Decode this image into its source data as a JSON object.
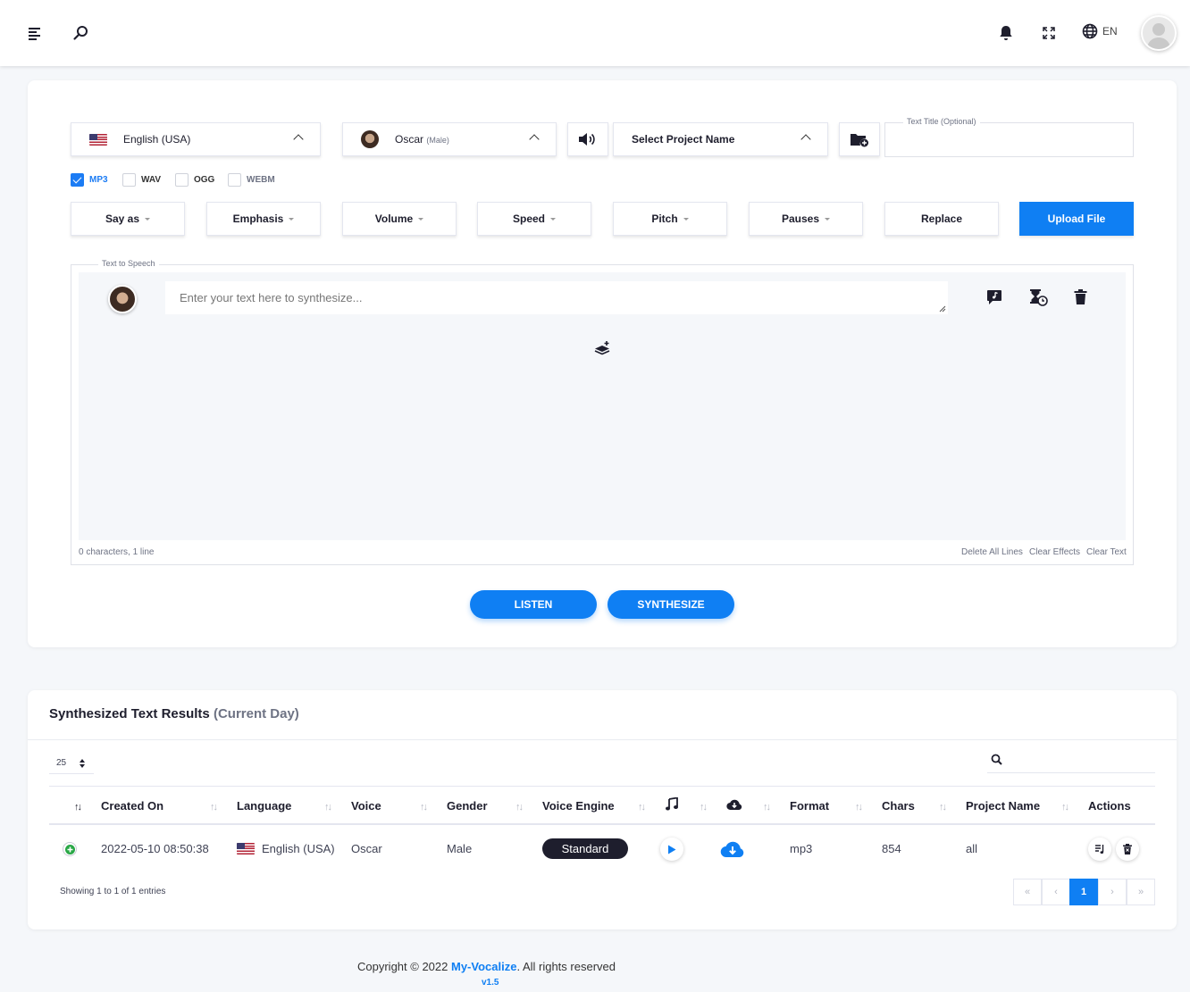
{
  "header": {
    "language_code": "EN"
  },
  "voice_panel": {
    "language": "English (USA)",
    "voice_name": "Oscar",
    "voice_gender_tag": "(Male)",
    "project_placeholder": "Select Project Name",
    "text_title_legend": "Text Title (Optional)"
  },
  "formats": [
    {
      "label": "MP3",
      "checked": true
    },
    {
      "label": "WAV",
      "checked": false
    },
    {
      "label": "OGG",
      "checked": false
    },
    {
      "label": "WEBM",
      "checked": false
    }
  ],
  "effects": [
    "Say as",
    "Emphasis",
    "Volume",
    "Speed",
    "Pitch",
    "Pauses",
    "Replace"
  ],
  "upload_label": "Upload File",
  "tts": {
    "legend": "Text to Speech",
    "placeholder": "Enter your text here to synthesize...",
    "counter": "0 characters, 1 line",
    "delete_all": "Delete All Lines",
    "clear_effects": "Clear Effects",
    "clear_text": "Clear Text"
  },
  "actions": {
    "listen": "LISTEN",
    "synthesize": "SYNTHESIZE"
  },
  "results": {
    "title": "Synthesized Text Results",
    "title_suffix": "(Current Day)",
    "page_size": "25",
    "columns": [
      "Created On",
      "Language",
      "Voice",
      "Gender",
      "Voice Engine",
      "Format",
      "Chars",
      "Project Name",
      "Actions"
    ],
    "rows": [
      {
        "created_on": "2022-05-10 08:50:38",
        "language": "English (USA)",
        "voice": "Oscar",
        "gender": "Male",
        "engine": "Standard",
        "format": "mp3",
        "chars": "854",
        "project": "all"
      }
    ],
    "info": "Showing 1 to 1 of 1 entries",
    "current_page": "1"
  },
  "footer": {
    "copyright_prefix": "Copyright © 2022 ",
    "brand": "My-Vocalize",
    "copyright_suffix": ". All rights reserved",
    "version": "v1.5"
  },
  "colors": {
    "primary": "#0f7ff3",
    "dark": "#1e1e2d",
    "muted": "#6e7384",
    "success": "#1bc5bd"
  }
}
